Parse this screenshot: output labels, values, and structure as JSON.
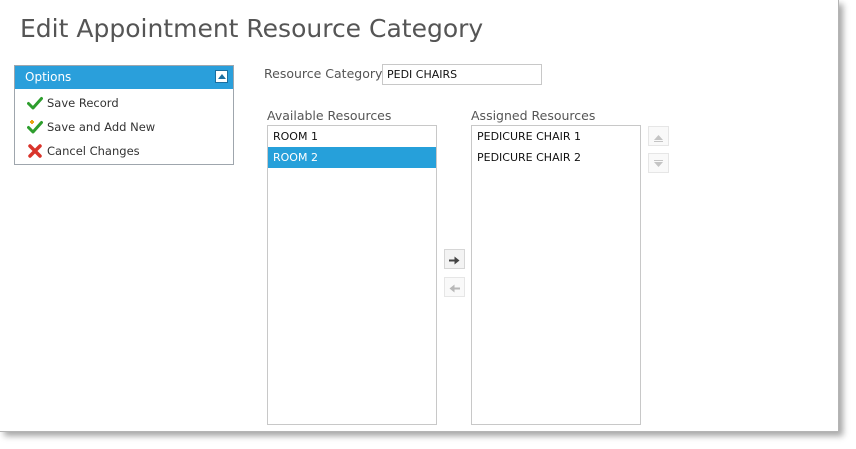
{
  "page": {
    "title": "Edit Appointment Resource Category"
  },
  "options": {
    "header": "Options",
    "items": [
      {
        "label": "Save Record",
        "icon": "checkmark-icon"
      },
      {
        "label": "Save and Add New",
        "icon": "checkmark-plus-icon"
      },
      {
        "label": "Cancel Changes",
        "icon": "red-x-icon"
      }
    ]
  },
  "resource_category": {
    "label": "Resource Category",
    "value": "PEDI CHAIRS"
  },
  "available": {
    "label": "Available Resources",
    "items": [
      "ROOM 1",
      "ROOM 2"
    ],
    "selected": "ROOM 2"
  },
  "assigned": {
    "label": "Assigned Resources",
    "items": [
      "PEDICURE CHAIR 1",
      "PEDICURE CHAIR 2"
    ]
  },
  "colors": {
    "accent": "#2a9fdb",
    "selected_row": "#26a0da",
    "title_text": "#555555",
    "check_green": "#2e9e2e",
    "cancel_red": "#d9342b"
  }
}
